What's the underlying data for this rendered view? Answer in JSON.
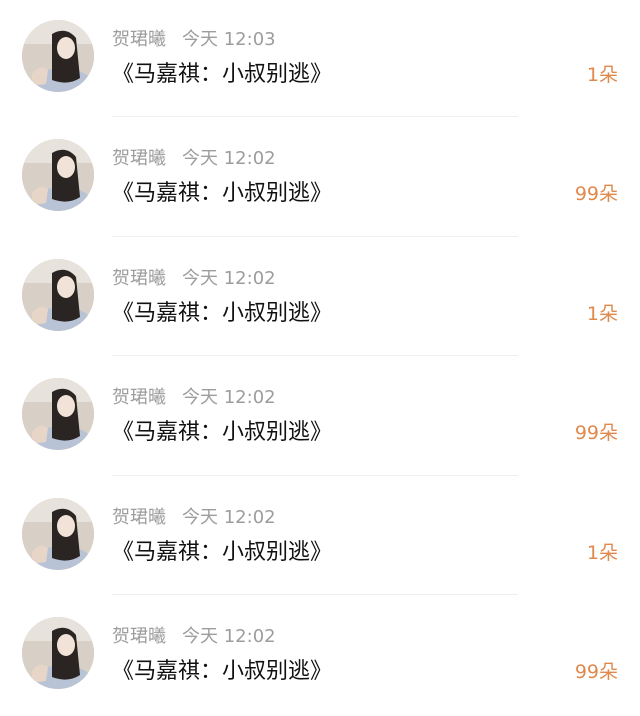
{
  "items": [
    {
      "username": "贺珺曦",
      "time": "今天 12:03",
      "title": "《马嘉祺：小叔别逃》",
      "count": "1朵"
    },
    {
      "username": "贺珺曦",
      "time": "今天 12:02",
      "title": "《马嘉祺：小叔别逃》",
      "count": "99朵"
    },
    {
      "username": "贺珺曦",
      "time": "今天 12:02",
      "title": "《马嘉祺：小叔别逃》",
      "count": "1朵"
    },
    {
      "username": "贺珺曦",
      "time": "今天 12:02",
      "title": "《马嘉祺：小叔别逃》",
      "count": "99朵"
    },
    {
      "username": "贺珺曦",
      "time": "今天 12:02",
      "title": "《马嘉祺：小叔别逃》",
      "count": "1朵"
    },
    {
      "username": "贺珺曦",
      "time": "今天 12:02",
      "title": "《马嘉祺：小叔别逃》",
      "count": "99朵"
    }
  ],
  "colors": {
    "count_accent": "#e0894c",
    "meta_gray": "#9d9d9d",
    "title_text": "#111111"
  }
}
